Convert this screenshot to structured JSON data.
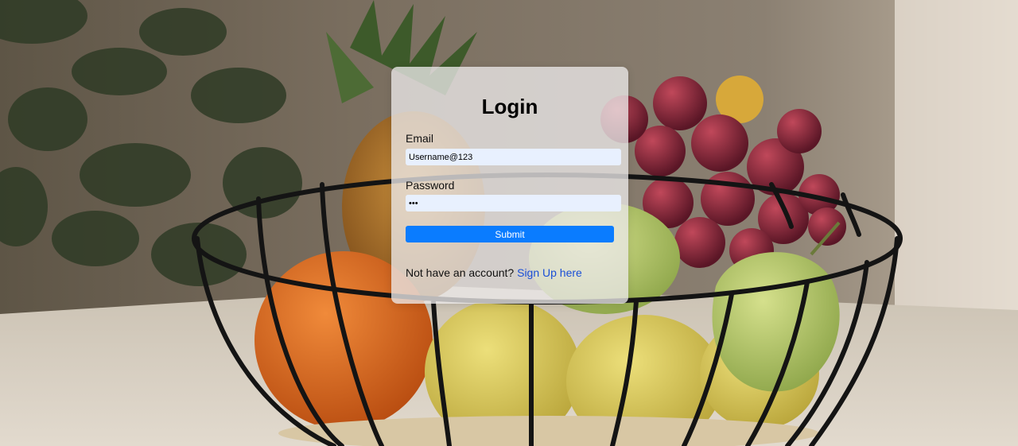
{
  "login": {
    "title": "Login",
    "email_label": "Email",
    "email_value": "Username@123",
    "password_label": "Password",
    "password_value": "abc",
    "submit_label": "Submit",
    "signup_prompt": "Not have an account?",
    "signup_link": "Sign Up here"
  },
  "colors": {
    "submit_button": "#0a7cff",
    "input_background": "#e8f0fe",
    "card_background": "#ebe8e8",
    "link": "#1a4fd6"
  }
}
